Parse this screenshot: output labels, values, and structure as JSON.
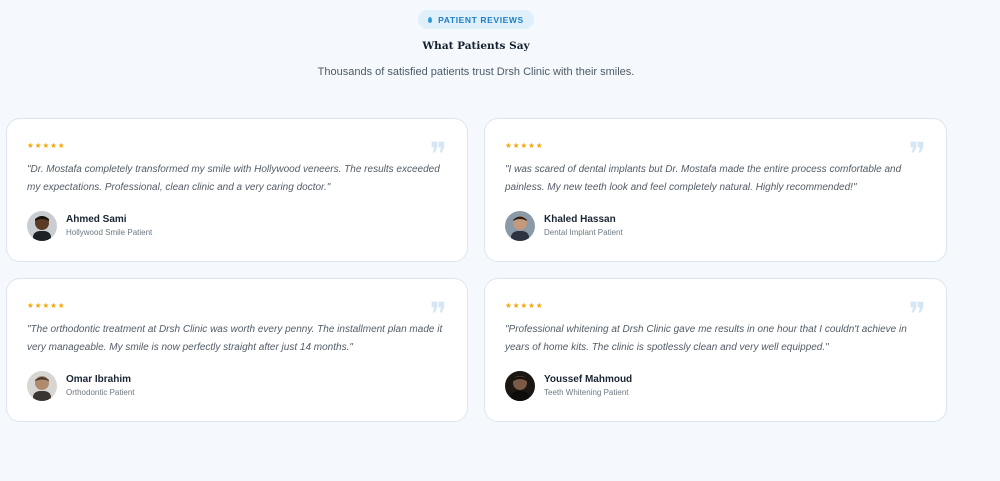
{
  "header": {
    "badge": "PATIENT REVIEWS",
    "title": "What Patients Say",
    "subtitle": "Thousands of satisfied patients trust Drsh Clinic with their smiles."
  },
  "reviews": [
    {
      "stars": "★★★★★",
      "quote_mark": "❞",
      "text": "\"Dr. Mostafa completely transformed my smile with Hollywood veneers. The results exceeded my expectations. Professional, clean clinic and a very caring doctor.\"",
      "name": "Ahmed Sami",
      "role": "Hollywood Smile Patient",
      "avatar_icon": "person-avatar-icon"
    },
    {
      "stars": "★★★★★",
      "quote_mark": "❞",
      "text": "\"I was scared of dental implants but Dr. Mostafa made the entire process comfortable and painless. My new teeth look and feel completely natural. Highly recommended!\"",
      "name": "Khaled Hassan",
      "role": "Dental Implant Patient",
      "avatar_icon": "person-avatar-icon"
    },
    {
      "stars": "★★★★★",
      "quote_mark": "❞",
      "text": "\"The orthodontic treatment at Drsh Clinic was worth every penny. The installment plan made it very manageable. My smile is now perfectly straight after just 14 months.\"",
      "name": "Omar Ibrahim",
      "role": "Orthodontic Patient",
      "avatar_icon": "person-avatar-icon"
    },
    {
      "stars": "★★★★★",
      "quote_mark": "❞",
      "text": "\"Professional whitening at Drsh Clinic gave me results in one hour that I couldn't achieve in years of home kits. The clinic is spotlessly clean and very well equipped.\"",
      "name": "Youssef Mahmoud",
      "role": "Teeth Whitening Patient",
      "avatar_icon": "person-avatar-icon"
    }
  ],
  "colors": {
    "accent": "#1f7fc4",
    "star": "#f2a60c",
    "quote_mark": "#d7e6f4",
    "background": "#f5f9fd"
  }
}
